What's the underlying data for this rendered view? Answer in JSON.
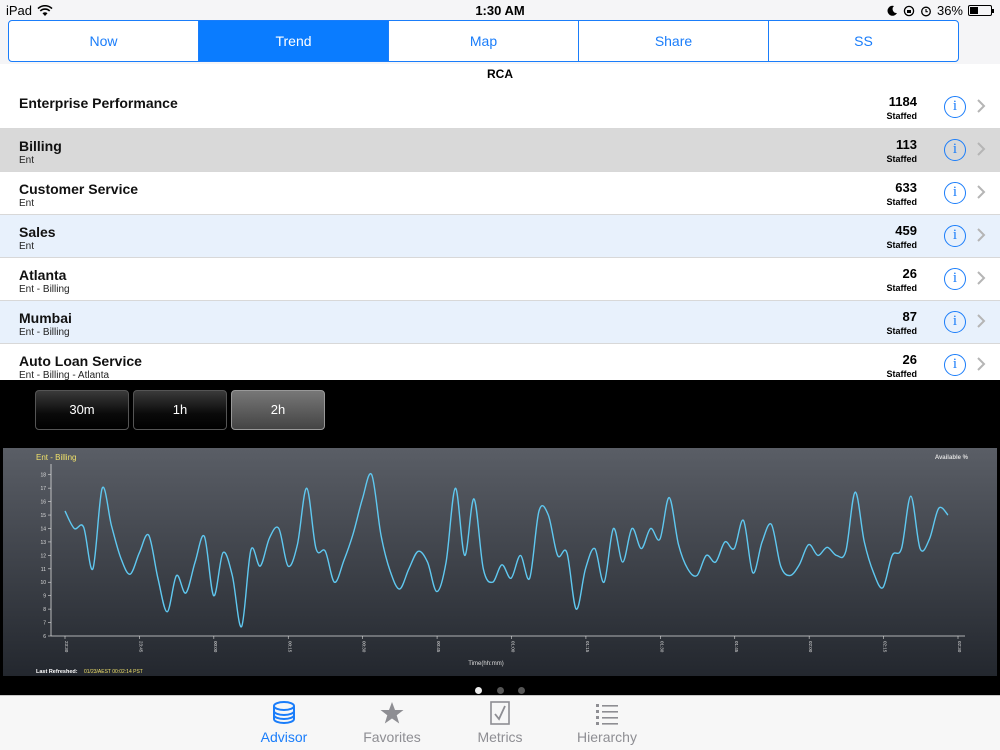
{
  "status": {
    "device": "iPad",
    "time": "1:30 AM",
    "battery": "36%"
  },
  "segments": [
    {
      "label": "Now",
      "active": false
    },
    {
      "label": "Trend",
      "active": true
    },
    {
      "label": "Map",
      "active": false
    },
    {
      "label": "Share",
      "active": false
    },
    {
      "label": "SS",
      "active": false
    }
  ],
  "section_title": "RCA",
  "rows": [
    {
      "name": "Enterprise Performance",
      "sub": "",
      "value": "1184",
      "unit": "Staffed"
    },
    {
      "name": "Billing",
      "sub": "Ent",
      "value": "113",
      "unit": "Staffed"
    },
    {
      "name": "Customer Service",
      "sub": "Ent",
      "value": "633",
      "unit": "Staffed"
    },
    {
      "name": "Sales",
      "sub": "Ent",
      "value": "459",
      "unit": "Staffed"
    },
    {
      "name": "Atlanta",
      "sub": "Ent - Billing",
      "value": "26",
      "unit": "Staffed"
    },
    {
      "name": "Mumbai",
      "sub": "Ent - Billing",
      "value": "87",
      "unit": "Staffed"
    },
    {
      "name": "Auto Loan Service",
      "sub": "Ent - Billing - Atlanta",
      "value": "26",
      "unit": "Staffed"
    }
  ],
  "ranges": [
    {
      "label": "30m",
      "active": false
    },
    {
      "label": "1h",
      "active": false
    },
    {
      "label": "2h",
      "active": true
    }
  ],
  "chart_data": {
    "type": "line",
    "title": "Ent - Billing",
    "legend": "Available %",
    "xlabel": "Time(hh:mm)",
    "ylabel": "",
    "ylim": [
      6,
      18.5
    ],
    "yticks": [
      6,
      7,
      8,
      9,
      10,
      11,
      12,
      13,
      14,
      15,
      16,
      17,
      18
    ],
    "xticks": [
      "23:30",
      "23:45",
      "00:00",
      "00:15",
      "00:30",
      "00:45",
      "01:00",
      "01:15",
      "01:30",
      "01:45",
      "02:00",
      "02:15",
      "02:30"
    ],
    "series": [
      {
        "name": "",
        "values": [
          15.3,
          14.0,
          14.1,
          11.0,
          17.0,
          14.2,
          11.8,
          10.6,
          12.2,
          13.5,
          10.3,
          7.8,
          10.5,
          9.2,
          11.5,
          13.4,
          9.0,
          12.2,
          10.5,
          6.7,
          12.4,
          11.2,
          13.3,
          14.0,
          11.2,
          12.8,
          17.0,
          12.5,
          12.3,
          10.0,
          11.6,
          13.6,
          16.2,
          18.0,
          13.5,
          10.8,
          9.5,
          11.0,
          12.3,
          11.5,
          9.3,
          11.5,
          17.0,
          12.0,
          16.2,
          11.0,
          10.0,
          11.3,
          10.3,
          12.0,
          10.3,
          15.3,
          15.0,
          12.0,
          12.2,
          8.0,
          11.0,
          12.5,
          10.0,
          14.0,
          11.5,
          14.0,
          12.5,
          14.0,
          13.2,
          16.3,
          12.8,
          11.0,
          10.5,
          12.0,
          11.5,
          13.0,
          12.5,
          14.6,
          10.7,
          13.0,
          14.3,
          11.2,
          10.5,
          11.3,
          12.8,
          12.0,
          12.6,
          12.0,
          12.3,
          16.7,
          13.0,
          10.7,
          9.6,
          12.0,
          12.5,
          16.4,
          12.5,
          13.2,
          15.5,
          15.0
        ]
      }
    ],
    "grid": false,
    "footer_label": "Last Refreshed:",
    "footer_value": "01/23/AEST 00:02:14 PST"
  },
  "tabs": [
    {
      "label": "Advisor",
      "icon": "database-icon",
      "active": true
    },
    {
      "label": "Favorites",
      "icon": "star-icon",
      "active": false
    },
    {
      "label": "Metrics",
      "icon": "document-check-icon",
      "active": false
    },
    {
      "label": "Hierarchy",
      "icon": "list-icon",
      "active": false
    }
  ],
  "colors": {
    "accent": "#0a7cff",
    "line": "#5fc8f0",
    "selected_row": "#d9d9d9",
    "alt_row": "#e8f1fc"
  }
}
